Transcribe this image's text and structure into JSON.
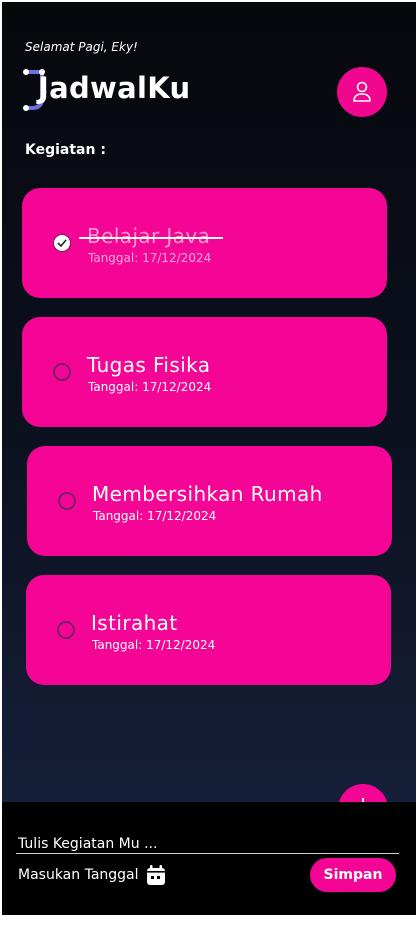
{
  "header": {
    "greeting": "Selamat Pagi, Eky!",
    "app_name": "JadwalKu",
    "profile_icon": "user-icon"
  },
  "section": {
    "label": "Kegiatan :"
  },
  "tasks": [
    {
      "title": "Belajar Java",
      "date": "Tanggal: 17/12/2024",
      "completed": true
    },
    {
      "title": "Tugas Fisika",
      "date": "Tanggal: 17/12/2024",
      "completed": false
    },
    {
      "title": "Membersihkan Rumah",
      "date": "Tanggal: 17/12/2024",
      "completed": false
    },
    {
      "title": "Istirahat",
      "date": "Tanggal: 17/12/2024",
      "completed": false
    }
  ],
  "form": {
    "task_placeholder": "Tulis Kegiatan Mu ...",
    "date_label": "Masukan Tanggal",
    "date_icon": "calendar-icon",
    "save_label": "Simpan"
  },
  "colors": {
    "accent": "#f40596",
    "background_top": "#07080c",
    "background_bottom": "#161f39",
    "check_border": "#7a1d6a"
  }
}
